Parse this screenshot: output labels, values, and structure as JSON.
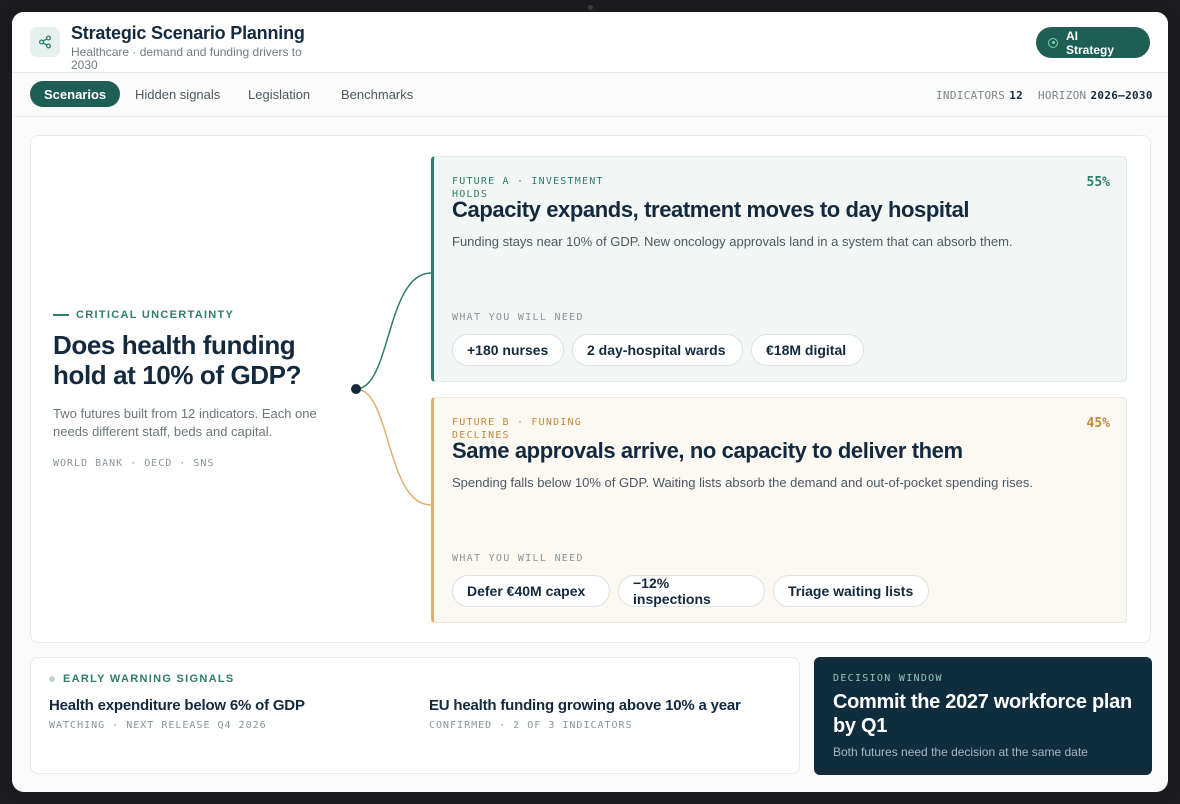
{
  "header": {
    "title": "Strategic Scenario Planning",
    "subtitle": "Healthcare · demand and funding drivers to 2030",
    "ai_button": "AI Strategy",
    "share_icon": "share-icon"
  },
  "tabs": [
    {
      "label": "Scenarios",
      "active": true
    },
    {
      "label": "Hidden signals",
      "active": false
    },
    {
      "label": "Legislation",
      "active": false
    },
    {
      "label": "Benchmarks",
      "active": false
    }
  ],
  "meta": {
    "indicators_label": "INDICATORS",
    "indicators_value": "12",
    "horizon_label": "HORIZON",
    "horizon_value": "2026–2030"
  },
  "uncertainty": {
    "label": "CRITICAL UNCERTAINTY",
    "question": "Does health funding hold at 10% of GDP?",
    "description": "Two futures built from 12 indicators. Each one needs different staff, beds and capital.",
    "sources": "WORLD BANK · OECD · SNS"
  },
  "futures": [
    {
      "tag": "FUTURE A · INVESTMENT HOLDS",
      "probability": "55%",
      "title": "Capacity expands, treatment moves to day hospital",
      "description": "Funding stays near 10% of GDP. New oncology approvals land in a system that can absorb them.",
      "need_label": "WHAT YOU WILL NEED",
      "needs": [
        "+180 nurses",
        "2 day-hospital wards",
        "€18M digital"
      ],
      "color": "#2f7d6b"
    },
    {
      "tag": "FUTURE B · FUNDING DECLINES",
      "probability": "45%",
      "title": "Same approvals arrive, no capacity to deliver them",
      "description": "Spending falls below 10% of GDP. Waiting lists absorb the demand and out-of-pocket spending rises.",
      "need_label": "WHAT YOU WILL NEED",
      "needs": [
        "Defer €40M capex",
        "−12% inspections",
        "Triage waiting lists"
      ],
      "color": "#e2b06e"
    }
  ],
  "signals": {
    "heading": "EARLY WARNING SIGNALS",
    "items": [
      {
        "title": "Health expenditure below 6% of GDP",
        "status": "WATCHING · NEXT RELEASE Q4 2026"
      },
      {
        "title": "EU health funding growing above 10% a year",
        "status": "CONFIRMED · 2 OF 3 INDICATORS"
      }
    ]
  },
  "decision": {
    "label": "DECISION WINDOW",
    "title": "Commit the 2027 workforce plan by Q1",
    "subtitle": "Both futures need the decision at the same date"
  }
}
